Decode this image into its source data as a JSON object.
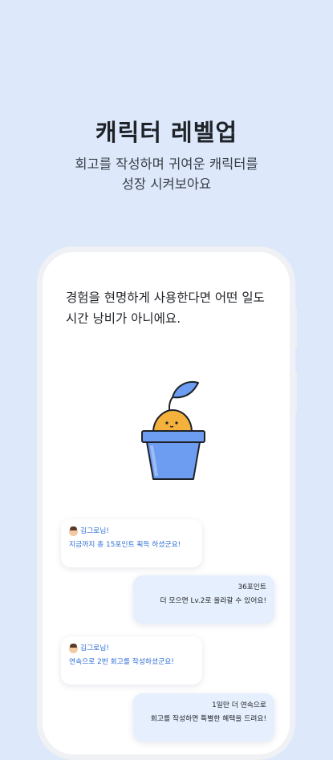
{
  "headline": "캐릭터 레벨업",
  "subline": "회고를 작성하며 귀여운 캐릭터를\n성장 시켜보아요",
  "phone": {
    "quote": "경험을 현명하게 사용한다면 어떤 일도\n시간 낭비가 아니에요.",
    "chat": [
      {
        "side": "left",
        "name": "김그로님!",
        "text": "지금까지 총 15포인트 획득 하셨군요!"
      },
      {
        "side": "right",
        "line1": "36포인트",
        "line2": "더 모으면 Lv.2로 올라갈 수 있어요!"
      },
      {
        "side": "left",
        "name": "김그로님!",
        "text": "연속으로 2번 회고를 작성하셨군요!"
      },
      {
        "side": "right",
        "line1": "1일만 더 연속으로",
        "line2": "회고를 작성하면 특별한 혜택을 드려요!"
      }
    ]
  },
  "colors": {
    "background": "#dde9fb",
    "pot": "#6c9df0",
    "seed": "#f4b23c",
    "accent": "#2f6fd6"
  },
  "icons": [
    "avatar-icon",
    "plant-pot-character-icon"
  ]
}
